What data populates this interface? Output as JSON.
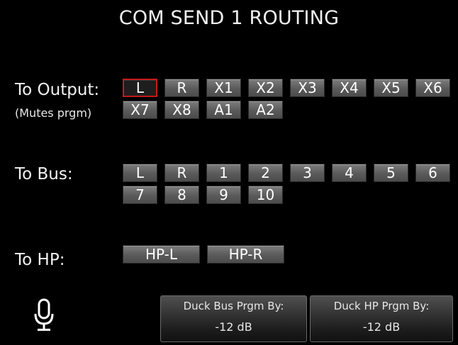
{
  "screen": {
    "title": "COM SEND 1 ROUTING"
  },
  "to_output": {
    "label": "To Output:",
    "sub_label": "(Mutes prgm)",
    "buttons": [
      "L",
      "R",
      "X1",
      "X2",
      "X3",
      "X4",
      "X5",
      "X6",
      "X7",
      "X8",
      "A1",
      "A2"
    ],
    "selected": [
      "L"
    ]
  },
  "to_bus": {
    "label": "To Bus:",
    "buttons": [
      "L",
      "R",
      "1",
      "2",
      "3",
      "4",
      "5",
      "6",
      "7",
      "8",
      "9",
      "10"
    ],
    "selected": []
  },
  "to_hp": {
    "label": "To HP:",
    "buttons": [
      "HP-L",
      "HP-R"
    ],
    "selected": []
  },
  "duck_bus": {
    "label": "Duck Bus Prgm By:",
    "value": "-12 dB"
  },
  "duck_hp": {
    "label": "Duck HP Prgm By:",
    "value": "-12 dB"
  },
  "icons": {
    "mic": "microphone-icon"
  },
  "colors": {
    "selected_border": "#c41a1a",
    "button_fill": "#5a5a5a",
    "background": "#000000"
  }
}
